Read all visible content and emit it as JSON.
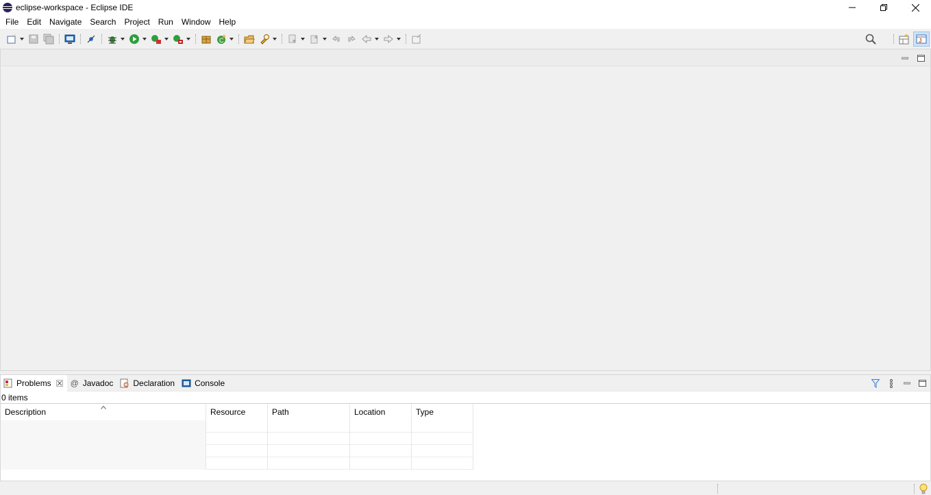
{
  "window": {
    "title": "eclipse-workspace - Eclipse IDE"
  },
  "menu": [
    "File",
    "Edit",
    "Navigate",
    "Search",
    "Project",
    "Run",
    "Window",
    "Help"
  ],
  "bottom_panel": {
    "tabs": [
      {
        "label": "Problems",
        "icon": "problems-icon",
        "active": true
      },
      {
        "label": "Javadoc",
        "icon": "javadoc-icon",
        "active": false
      },
      {
        "label": "Declaration",
        "icon": "declaration-icon",
        "active": false
      },
      {
        "label": "Console",
        "icon": "console-icon",
        "active": false
      }
    ],
    "items_count": "0 items",
    "columns": [
      "Description",
      "Resource",
      "Path",
      "Location",
      "Type"
    ]
  },
  "colors": {
    "chrome": "#f0f0f0",
    "accent_blue": "#1c66b5",
    "run_green": "#2e9e3e",
    "perspective_active": "#cfe3f5"
  }
}
